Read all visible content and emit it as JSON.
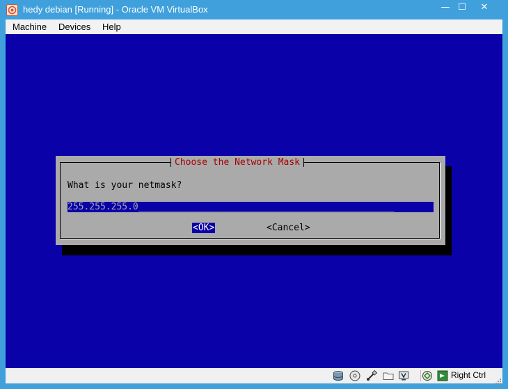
{
  "window": {
    "title": "hedy debian [Running] - Oracle VM VirtualBox",
    "minimize_glyph": "—",
    "maximize_glyph": "☐",
    "close_glyph": "✕",
    "colors": {
      "frame": "#3fa0dc",
      "vm_background": "#0a02a8",
      "dialog": "#aaaaaa"
    }
  },
  "menubar": {
    "items": [
      "Machine",
      "Devices",
      "Help"
    ]
  },
  "dialog": {
    "title": "Choose the Network Mask",
    "question": "What is your netmask?",
    "input_value": "255.255.255.0_______________________________________________",
    "ok_label": "<OK>",
    "cancel_label": "<Cancel>"
  },
  "statusbar": {
    "icons": [
      "hard-disk-icon",
      "optical-drive-icon",
      "usb-icon",
      "shared-folders-icon",
      "display-icon",
      "network-icon",
      "capture-icon"
    ],
    "host_key": "Right Ctrl"
  }
}
